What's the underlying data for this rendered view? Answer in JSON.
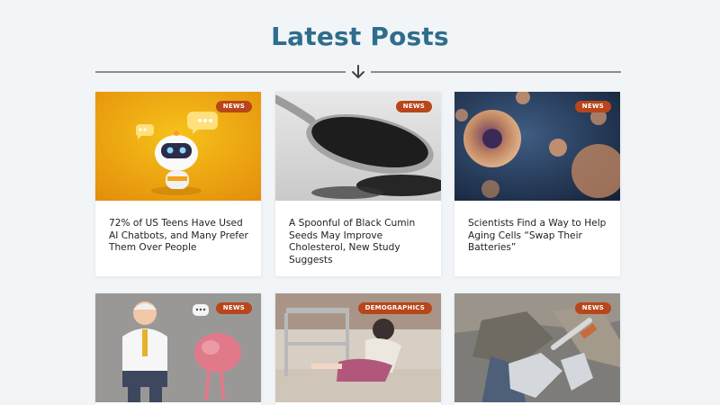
{
  "header": {
    "title": "Latest Posts",
    "arrow_icon": "arrow-down-icon"
  },
  "colors": {
    "title": "#2f6d8c",
    "badge": "#b8461a",
    "background": "#f2f5f8"
  },
  "posts": [
    {
      "category": "NEWS",
      "title": "72% of US Teens Have Used AI Chatbots, and Many Prefer Them Over People",
      "image": "robot-chatbot-illustration"
    },
    {
      "category": "NEWS",
      "title": "A Spoonful of Black Cumin Seeds May Improve Cholesterol, New Study Suggests",
      "image": "spoon-black-cumin-seeds"
    },
    {
      "category": "NEWS",
      "title": "Scientists Find a Way to Help Aging Cells “Swap Their Batteries”",
      "image": "cells-microscopy"
    },
    {
      "category": "NEWS",
      "title": "",
      "image": "elderly-man-and-brain-illustration"
    },
    {
      "category": "DEMOGRAPHICS",
      "title": "",
      "image": "woman-fallen-near-walker"
    },
    {
      "category": "NEWS",
      "title": "",
      "image": "hands-with-hammer-on-rocks"
    }
  ]
}
